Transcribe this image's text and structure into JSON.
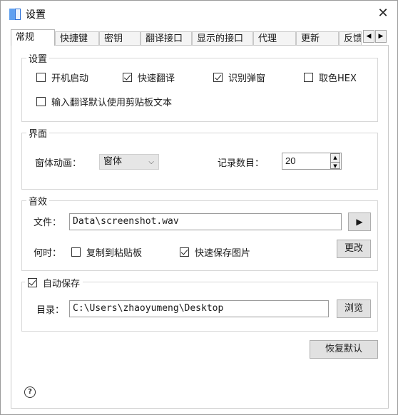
{
  "window": {
    "title": "设置",
    "close_glyph": "✕"
  },
  "tabs": [
    "常规",
    "快捷键",
    "密钥",
    "翻译接口",
    "显示的接口",
    "代理",
    "更新",
    "反馈"
  ],
  "tab_scroll": {
    "left": "◀",
    "right": "▶"
  },
  "settings_group": {
    "title": "设置",
    "auto_start": {
      "label": "开机启动",
      "checked": false
    },
    "quick_translate": {
      "label": "快速翻译",
      "checked": true
    },
    "recognize_popup": {
      "label": "识别弹窗",
      "checked": true
    },
    "pick_color_hex": {
      "label": "取色HEX",
      "checked": false
    },
    "default_clipboard": {
      "label": "输入翻译默认使用剪贴板文本",
      "checked": false
    }
  },
  "interface_group": {
    "title": "界面",
    "animation_label": "窗体动画：",
    "animation_value": "窗体",
    "record_count_label": "记录数目：",
    "record_count_value": "20"
  },
  "sound_group": {
    "title": "音效",
    "file_label": "文件：",
    "file_value": "Data\\screenshot.wav",
    "play_glyph": "▶",
    "when_label": "何时：",
    "copy_clipboard": {
      "label": "复制到粘贴板",
      "checked": false
    },
    "quick_save_image": {
      "label": "快速保存图片",
      "checked": true
    },
    "change_button": "更改"
  },
  "autosave_group": {
    "title": "自动保存",
    "checked": true,
    "dir_label": "目录：",
    "dir_value": "C:\\Users\\zhaoyumeng\\Desktop",
    "browse_button": "浏览"
  },
  "restore_defaults_button": "恢复默认",
  "help_glyph": "?",
  "colors": {
    "app_icon_blue": "#2b6fd6",
    "border": "#c9c9c9",
    "button_bg": "#e1e1e1"
  }
}
